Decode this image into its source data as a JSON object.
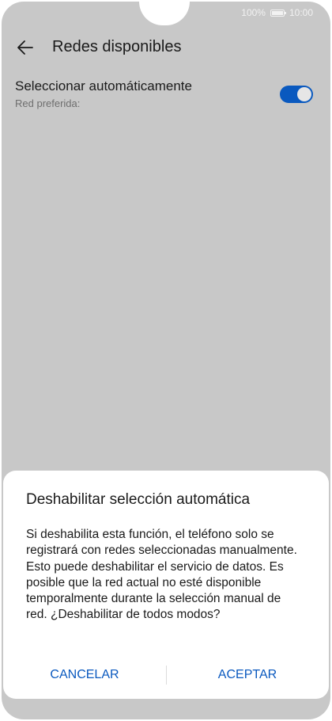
{
  "status_bar": {
    "battery_percent": "100%",
    "time": "10:00"
  },
  "app_bar": {
    "title": "Redes disponibles",
    "back_icon": "arrow-left-icon"
  },
  "setting": {
    "title": "Seleccionar automáticamente",
    "subtitle": "Red preferida:",
    "toggle_on": true
  },
  "dialog": {
    "title": "Deshabilitar selección automática",
    "message": "Si deshabilita esta función, el teléfono solo se registrará con redes seleccionadas manualmente. Esto puede deshabilitar el servicio de datos. Es posible que la red actual no esté disponible temporalmente durante la selección manual de red. ¿Deshabilitar de todos modos?",
    "cancel_label": "CANCELAR",
    "accept_label": "ACEPTAR"
  },
  "colors": {
    "accent": "#0a59bf",
    "scrim_background": "#c8c8c8",
    "dialog_background": "#ffffff",
    "text_primary": "#1a1a1a",
    "text_secondary": "#6e6e6e"
  }
}
